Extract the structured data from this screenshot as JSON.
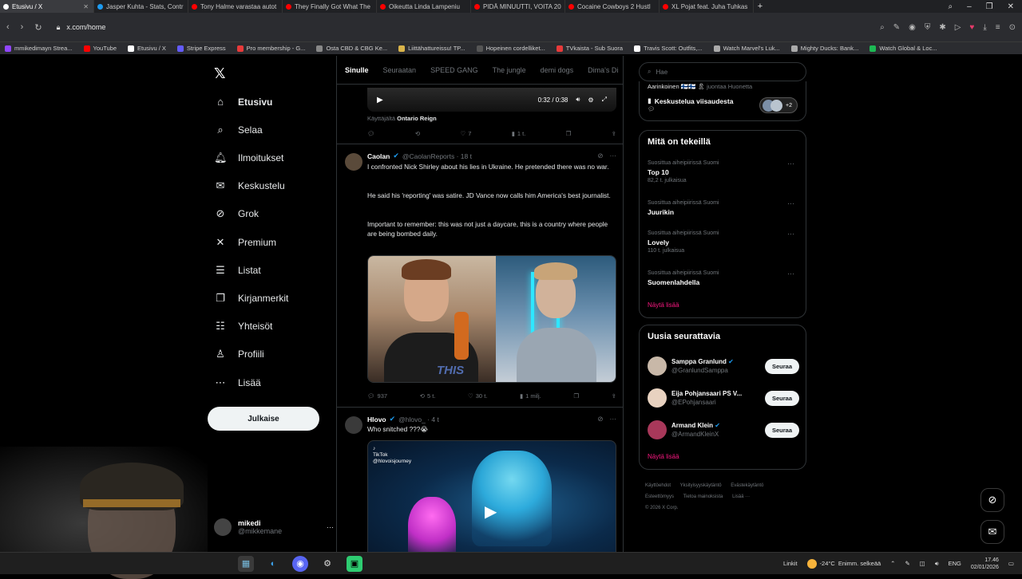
{
  "browser": {
    "tabs": [
      {
        "label": "Etusivu / X",
        "color": "#ffffff",
        "active": true
      },
      {
        "label": "Jasper Kuhta - Stats, Contr",
        "color": "#1d9bf0"
      },
      {
        "label": "Tony Halme varastaa autot",
        "color": "#ff0000"
      },
      {
        "label": "They Finally Got What The",
        "color": "#ff0000"
      },
      {
        "label": "Oikeutta Linda Lampeniu",
        "color": "#ff0000"
      },
      {
        "label": "PIDÄ MINUUTTI, VOITA 20",
        "color": "#ff0000"
      },
      {
        "label": "Cocaine Cowboys 2 Hustl",
        "color": "#ff0000"
      },
      {
        "label": "XL Pojat feat. Juha Tuhkas",
        "color": "#ff0000"
      }
    ],
    "url": "x.com/home",
    "bookmarks": [
      {
        "label": "mmikedimayn Strea...",
        "color": "#9146ff"
      },
      {
        "label": "YouTube",
        "color": "#ff0000"
      },
      {
        "label": "Etusivu / X",
        "color": "#ffffff"
      },
      {
        "label": "Stripe Express",
        "color": "#635bff"
      },
      {
        "label": "Pro membership - G...",
        "color": "#e83a3a"
      },
      {
        "label": "Osta CBD & CBG Ke...",
        "color": "#888888"
      },
      {
        "label": "Liittähattureissu! TP...",
        "color": "#d9b44a"
      },
      {
        "label": "Hopeinen cordelliket...",
        "color": "#555555"
      },
      {
        "label": "TVkaista - Sub Suora",
        "color": "#e83a3a"
      },
      {
        "label": "Travis Scott: Outfits,...",
        "color": "#ffffff"
      },
      {
        "label": "Watch Marvel's Luk...",
        "color": "#aaaaaa"
      },
      {
        "label": "Mighty Ducks: Bank...",
        "color": "#aaaaaa"
      },
      {
        "label": "Watch Global & Loc...",
        "color": "#1db954"
      }
    ]
  },
  "nav": {
    "items": [
      {
        "label": "Etusivu",
        "icon": "home-icon",
        "glyph": "⌂"
      },
      {
        "label": "Selaa",
        "icon": "search-icon",
        "glyph": "⌕"
      },
      {
        "label": "Ilmoitukset",
        "icon": "bell-icon",
        "glyph": "♫"
      },
      {
        "label": "Keskustelu",
        "icon": "mail-icon",
        "glyph": "✉"
      },
      {
        "label": "Grok",
        "icon": "grok-icon",
        "glyph": "⊘"
      },
      {
        "label": "Premium",
        "icon": "x-icon",
        "glyph": "✕"
      },
      {
        "label": "Listat",
        "icon": "list-icon",
        "glyph": "☰"
      },
      {
        "label": "Kirjanmerkit",
        "icon": "bookmark-icon",
        "glyph": "❐"
      },
      {
        "label": "Yhteisöt",
        "icon": "communities-icon",
        "glyph": "☷"
      },
      {
        "label": "Profiili",
        "icon": "profile-icon",
        "glyph": "♙"
      },
      {
        "label": "Lisää",
        "icon": "more-icon",
        "glyph": "⋯"
      }
    ],
    "post_button": "Julkaise",
    "account": {
      "name": "mikedi",
      "handle": "@mikkemane"
    }
  },
  "timeline": {
    "tabs": [
      "Sinulle",
      "Seuraatan",
      "SPEED GANG",
      "The jungle",
      "demi dogs",
      "Dima's Di"
    ],
    "prev_tweet": {
      "video_time": "0:32 / 0:38",
      "credit_prefix": "Käyttäjältä",
      "credit_name": "Ontario Reign",
      "likes": "7",
      "views": "1 t."
    },
    "tweet1": {
      "name": "Caolan",
      "handle": "@CaolanReports · 18 t",
      "text1": "I confronted Nick Shirley about his lies in Ukraine. He pretended there was no war.",
      "text2": "He said his 'reporting' was satire. JD Vance now calls him America's best journalist.",
      "text3": "Important to remember: this was not just a daycare, this is a country where people are being bombed daily.",
      "caption": "THIS",
      "replies": "937",
      "reposts": "5 t.",
      "likes": "30 t.",
      "views": "1 milj."
    },
    "tweet2": {
      "name": "Hlovo",
      "handle": "@hlovo_ · 4 t",
      "text": "Who snitched ???😭",
      "tiktok": "TikTok",
      "tiktok_handle": "@hlovoisjourney"
    }
  },
  "right": {
    "search_placeholder": "Hae",
    "chat": {
      "line": "Aarinkoinen 🇫🇮🇫🇮 🎗",
      "line_muted": "juontaa Huonetta",
      "label": "Keskustelua viisaudesta",
      "count": "+2"
    },
    "trends_title": "Mitä on tekeillä",
    "trends": [
      {
        "context": "Suosittua aiheipiirissä Suomi",
        "name": "Top 10",
        "count": "82,2 t. julkaisua"
      },
      {
        "context": "Suosittua aiheipiirissä Suomi",
        "name": "Juurikin",
        "count": ""
      },
      {
        "context": "Suosittua aiheipiirissä Suomi",
        "name": "Lovely",
        "count": "110 t. julkaisua"
      },
      {
        "context": "Suosittua aiheipiirissä Suomi",
        "name": "Suomenlahdella",
        "count": ""
      }
    ],
    "show_more": "Näytä lisää",
    "follow_title": "Uusia seurattavia",
    "follow": [
      {
        "name": "Samppa Granlund",
        "handle": "@GranlundSamppa",
        "button": "Seuraa"
      },
      {
        "name": "Eija Pohjansaari PS V...",
        "handle": "@EPohjansaari",
        "button": "Seuraa"
      },
      {
        "name": "Armand Klein",
        "handle": "@ArmandKleinX",
        "button": "Seuraa"
      }
    ],
    "footer": [
      "Käyttöehdot",
      "Yksityisyyskäytäntö",
      "Evästekäytäntö",
      "Esteettömyys",
      "Tietoa mainoksista",
      "Lisää ···",
      "© 2026 X Corp."
    ]
  },
  "taskbar": {
    "links": "Linkit",
    "temp": "-24°C",
    "weather": "Enimm. selkeää",
    "lang": "ENG",
    "time": "17.46",
    "date": "02/01/2026"
  }
}
